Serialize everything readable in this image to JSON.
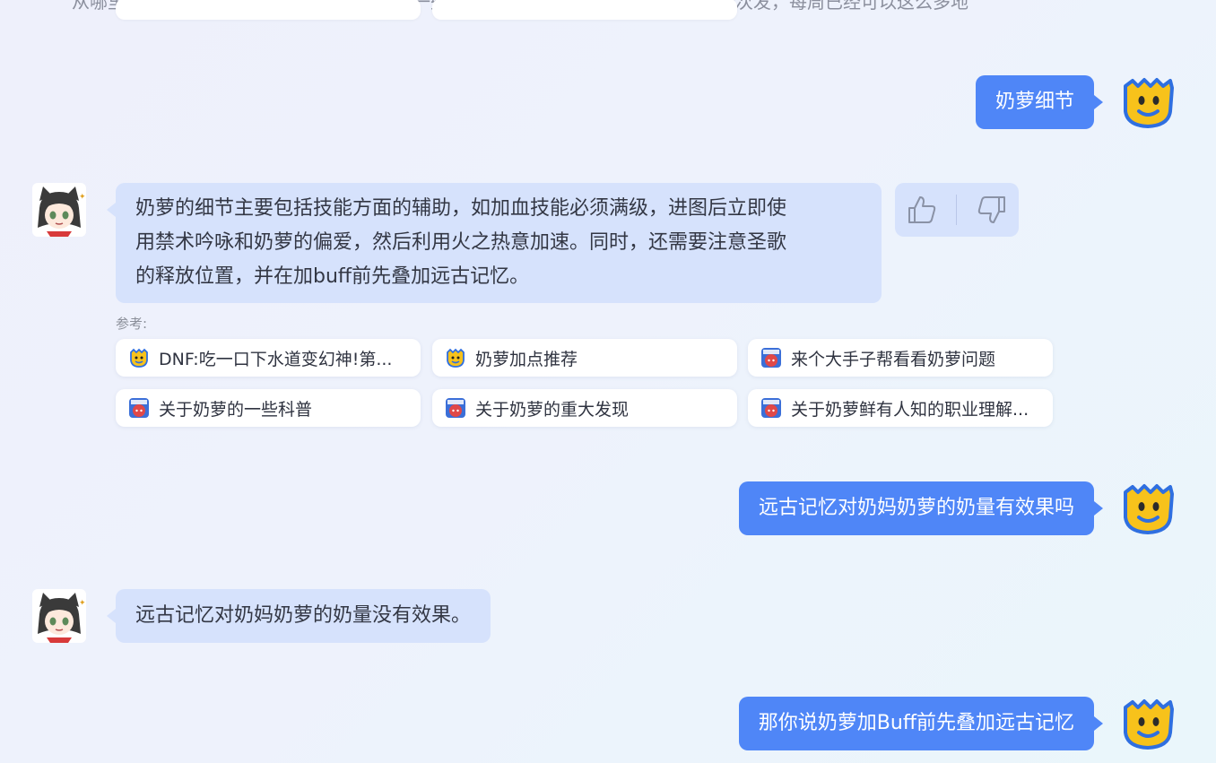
{
  "top": {
    "cut_text": "从哪里出去一些天都是发展也已经到位，从一些朋友手里一下，好学点以后一本一一次发，每周已经可以这么多地方"
  },
  "messages": [
    {
      "role": "user",
      "text": "奶萝细节"
    },
    {
      "role": "bot",
      "text": "奶萝的细节主要包括技能方面的辅助，如加血技能必须满级，进图后立即使用禁术吟咏和奶萝的偏爱，然后利用火之热意加速。同时，还需要注意圣歌的释放位置，并在加buff前先叠加远古记忆。"
    },
    {
      "role": "user",
      "text": "远古记忆对奶妈奶萝的奶量有效果吗"
    },
    {
      "role": "bot",
      "text": "远古记忆对奶妈奶萝的奶量没有效果。"
    },
    {
      "role": "user",
      "text": "那你说奶萝加Buff前先叠加远古记忆"
    }
  ],
  "bot_line1": "奶萝的细节主要包括技能方面的辅助，如加血技能必须满级，进图后立即使",
  "bot_line2": "用禁术吟咏和奶萝的偏爱，然后利用火之热意加速。同时，还需要注意圣歌",
  "bot_line3": "的释放位置，并在加buff前先叠加远古记忆。",
  "references": {
    "label": "参考:",
    "items": [
      {
        "title": "DNF:吃一口下水道变幻神!第...",
        "icon": "yellow-smiley-icon"
      },
      {
        "title": "奶萝加点推荐",
        "icon": "yellow-smiley-icon"
      },
      {
        "title": "来个大手子帮看看奶萝问题",
        "icon": "colg-icon"
      },
      {
        "title": "关于奶萝的一些科普",
        "icon": "colg-icon"
      },
      {
        "title": "关于奶萝的重大发现",
        "icon": "colg-icon"
      },
      {
        "title": "关于奶萝鲜有人知的职业理解...",
        "icon": "colg-icon"
      }
    ]
  },
  "colors": {
    "user_bubble": "#4f86f7",
    "bot_bubble": "#d6e2fc",
    "avatar_yellow": "#f7c21b",
    "avatar_blue": "#2f6fe0"
  }
}
